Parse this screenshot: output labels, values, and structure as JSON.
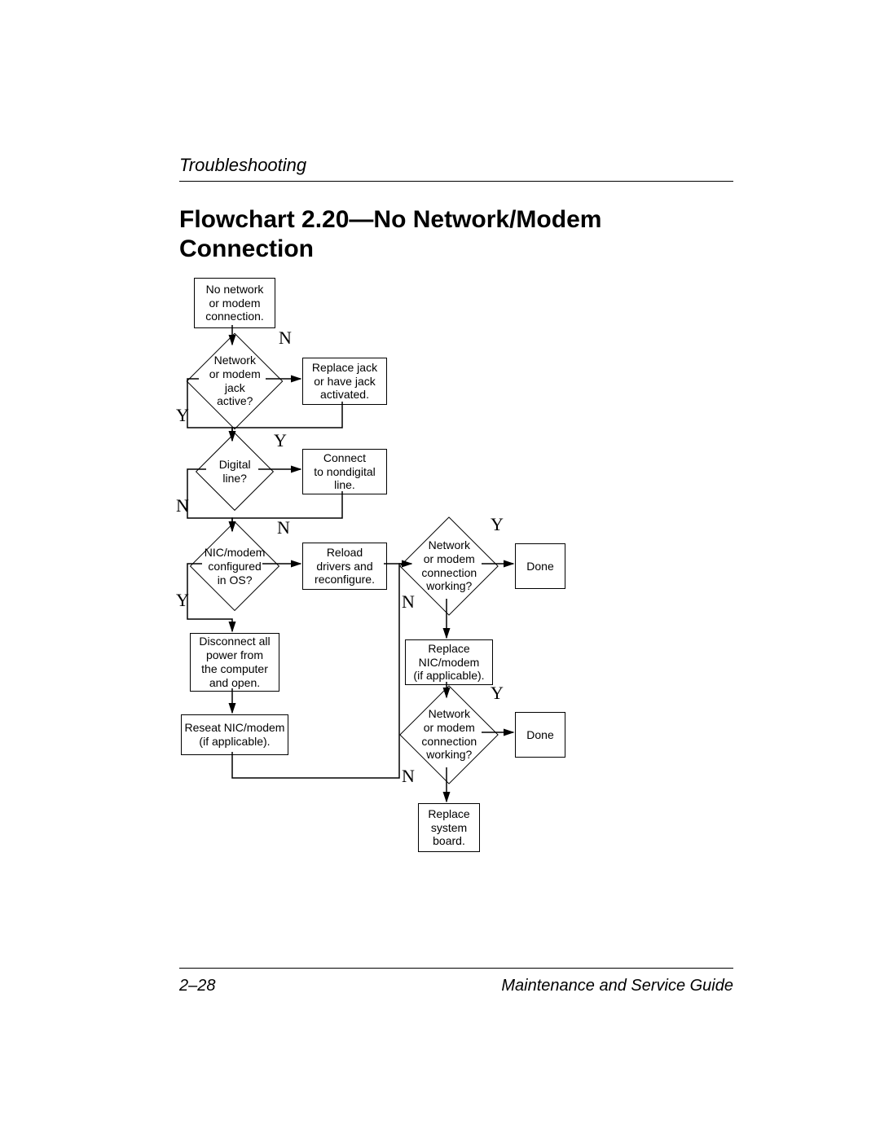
{
  "header": "Troubleshooting",
  "title_line1": "Flowchart 2.20—No Network/Modem",
  "title_line2": "Connection",
  "footer_left": "2–28",
  "footer_right": "Maintenance and Service Guide",
  "nodes": {
    "start": "No network\nor modem\nconnection.",
    "d1": "Network\nor modem jack\nactive?",
    "p1": "Replace jack\nor have jack\nactivated.",
    "d2": "Digital\nline?",
    "p2": "Connect\nto nondigital\nline.",
    "d3": "NIC/modem\nconfigured\nin OS?",
    "p3": "Reload\ndrivers and\nreconfigure.",
    "d4": "Network\nor modem\nconnection\nworking?",
    "done1": "Done",
    "p4": "Disconnect all\npower from\nthe computer\nand open.",
    "p5": "Replace\nNIC/modem\n(if applicable).",
    "p6": "Reseat NIC/modem\n(if applicable).",
    "d5": "Network\nor modem\nconnection\nworking?",
    "done2": "Done",
    "p7": "Replace\nsystem\nboard."
  },
  "labels": {
    "Y": "Y",
    "N": "N"
  }
}
